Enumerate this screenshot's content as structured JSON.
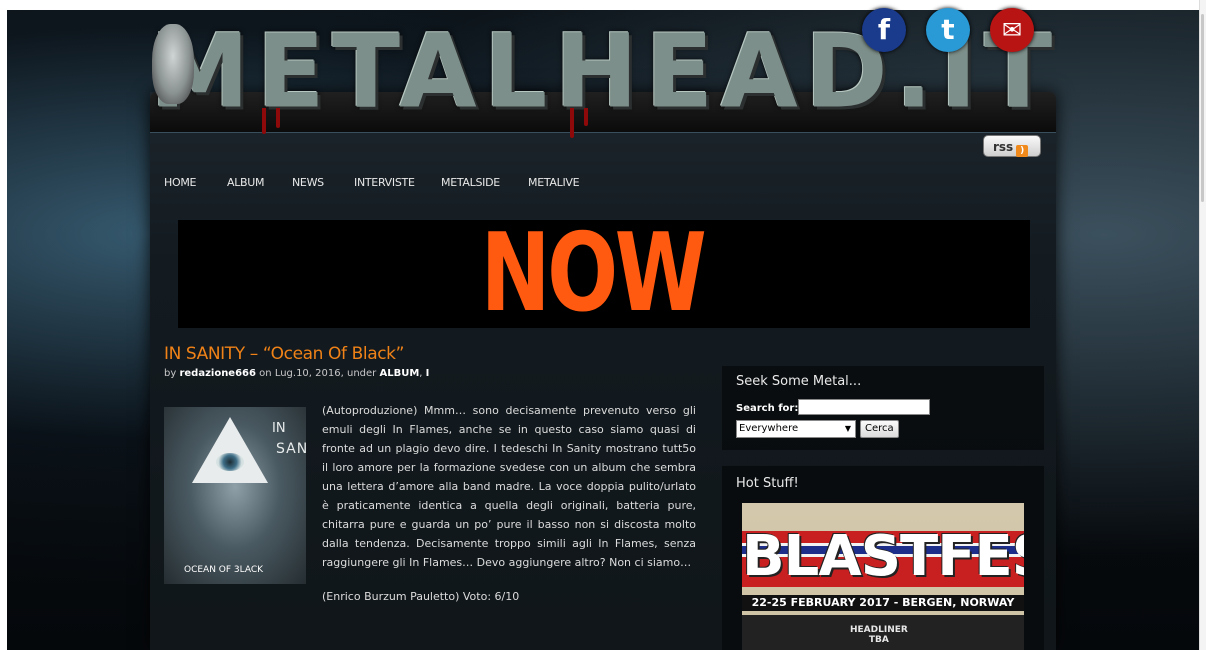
{
  "site": {
    "logo_text": "METALHEAD.IT",
    "social": {
      "facebook": "f",
      "twitter": "t",
      "email": "✉"
    },
    "rss_label": "rss"
  },
  "nav": {
    "items": [
      "HOME",
      "ALBUM",
      "NEWS",
      "INTERVISTE",
      "METALSIDE",
      "METALIVE"
    ]
  },
  "banner": {
    "text": "NOW"
  },
  "post": {
    "title": "IN SANITY – “Ocean Of Black”",
    "meta_prefix": "by",
    "author": "redazione666",
    "date_prefix": "on",
    "date": "Lug.10, 2016,",
    "under_prefix": "under",
    "category": "ALBUM",
    "category_sep": ",",
    "category2": "I",
    "cover": {
      "line1": "IN",
      "line2": "SANITY",
      "caption": "OCEAN OF 3LACK"
    },
    "body": "(Autoproduzione) Mmm… sono decisamente prevenuto verso gli emuli degli In Flames, anche se in questo caso siamo quasi di fronte ad un plagio devo dire. I tedeschi In Sanity mostrano tutt5o il loro amore per la formazione svedese con un album che sembra una lettera d’amore alla band madre. La voce doppia pulito/urlato è praticamente identica a quella degli originali, batteria pure, chitarra pure e guarda un po’ pure il basso non si discosta molto dalla tendenza. Decisamente troppo simili agli In Flames, senza raggiungere gli In Flames… Devo aggiungere altro? Non ci siamo…",
    "vote": "(Enrico Burzum Pauletto) Voto: 6/10"
  },
  "sidebar": {
    "search": {
      "title": "Seek Some Metal...",
      "label": "Search for:",
      "value": "",
      "scope": "Everywhere",
      "button": "Cerca"
    },
    "hot": {
      "title": "Hot Stuff!",
      "poster_title": "BLASTFEST",
      "poster_dates": "22-25 FEBRUARY 2017 - BERGEN, NORWAY",
      "poster_headliner": "HEADLINER",
      "poster_tba": "TBA"
    }
  },
  "colors": {
    "accent_orange": "#f08217",
    "banner_orange": "#ff5a10"
  }
}
